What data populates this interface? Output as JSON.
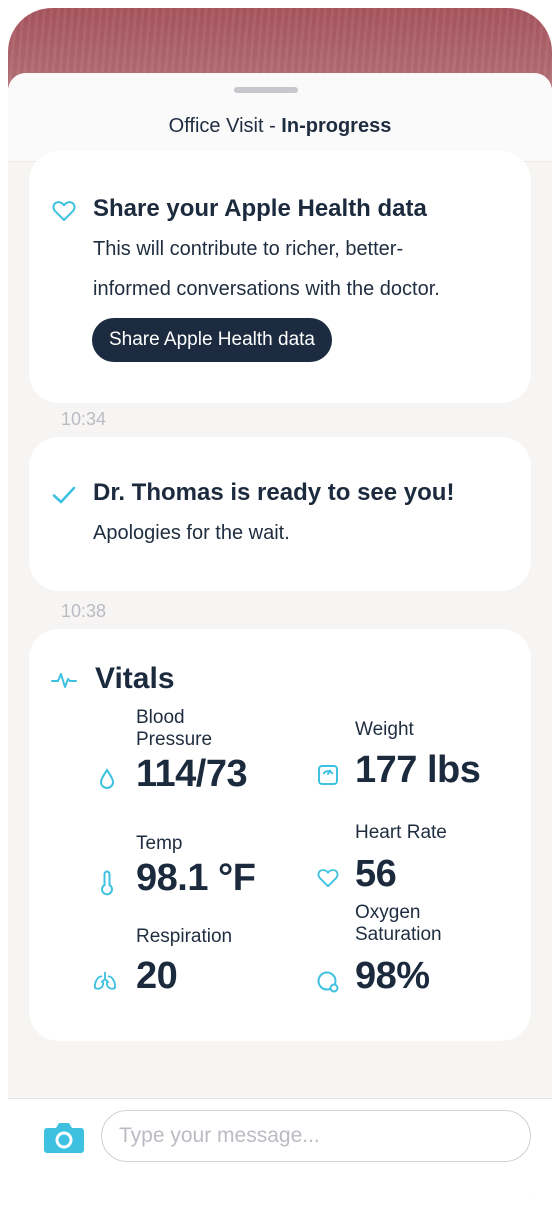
{
  "header": {
    "title_prefix": "Office Visit - ",
    "title_status": "In-progress"
  },
  "health_card": {
    "icon": "heart-outline-icon",
    "title": "Share your Apple Health data",
    "body_line1": "This will contribute to richer, better-",
    "body_line2": "informed conversations with the doctor.",
    "button_label": "Share Apple Health data"
  },
  "timestamps": [
    "10:34",
    "10:38"
  ],
  "ready_card": {
    "icon": "checkmark-icon",
    "title": "Dr. Thomas is ready to see you!",
    "body": "Apologies for the wait."
  },
  "vitals": {
    "icon": "pulse-icon",
    "title": "Vitals",
    "items": [
      {
        "label_line1": "Blood",
        "label_line2": "Pressure",
        "value": "114/73",
        "icon": "droplet-icon"
      },
      {
        "label_line1": "Weight",
        "label_line2": "",
        "value": "177 lbs",
        "icon": "scale-icon"
      },
      {
        "label_line1": "Temp",
        "label_line2": "",
        "value": "98.1 °F",
        "icon": "thermometer-icon"
      },
      {
        "label_line1": "Heart Rate",
        "label_line2": "",
        "value": "56",
        "icon": "heart-icon"
      },
      {
        "label_line1": "Respiration",
        "label_line2": "",
        "value": "20",
        "icon": "lungs-icon"
      },
      {
        "label_line1": "Oxygen",
        "label_line2": "Saturation",
        "value": "98%",
        "icon": "oxygen-icon"
      }
    ]
  },
  "composer": {
    "camera_icon": "camera-icon",
    "placeholder": "Type your message..."
  },
  "colors": {
    "accent": "#3ec1e0",
    "navy": "#1d2b40",
    "hero": "#a7545d",
    "timestamp": "#b9bcc2"
  }
}
